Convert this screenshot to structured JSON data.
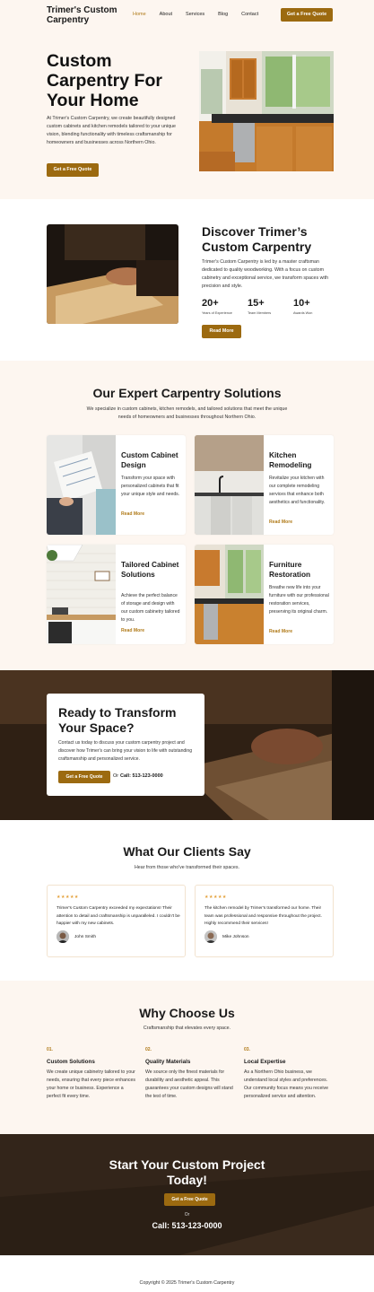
{
  "header": {
    "logo": "Trimer's Custom Carpentry",
    "nav": [
      "Home",
      "About",
      "Services",
      "Blog",
      "Contact"
    ],
    "active": "Home",
    "cta": "Get a Free Quote"
  },
  "hero": {
    "title": "Custom Carpentry For Your Home",
    "text": "At Trimer's Custom Carpentry, we create beautifully designed custom cabinets and kitchen remodels tailored to your unique vision, blending functionality with timeless craftsmanship for homeowners and businesses across Northern Ohio.",
    "button": "Get a Free Quote"
  },
  "discover": {
    "title": "Discover Trimer’s Custom Carpentry",
    "text": "Trimer's Custom Carpentry is led by a master craftsman dedicated to quality woodworking. With a focus on custom cabinetry and exceptional service, we transform spaces with precision and style.",
    "stats": [
      {
        "num": "20+",
        "label": "Years of Experience"
      },
      {
        "num": "15+",
        "label": "Team Members"
      },
      {
        "num": "10+",
        "label": "Awards Won"
      }
    ],
    "button": "Read More"
  },
  "services": {
    "title": "Our Expert Carpentry Solutions",
    "subtitle": "We specialize in custom cabinets, kitchen remodels, and tailored solutions that meet the unique needs of homeowners and businesses throughout Northern Ohio.",
    "cards": [
      {
        "title": "Custom Cabinet Design",
        "text": "Transform your space with personalized cabinets that fit your unique style and needs.",
        "link": "Read More"
      },
      {
        "title": "Kitchen Remodeling",
        "text": "Revitalize your kitchen with our complete remodeling services that enhance both aesthetics and functionality.",
        "link": "Read More"
      },
      {
        "title": "Tailored Cabinet Solutions",
        "text": "Achieve the perfect balance of storage and design with our custom cabinetry tailored to you.",
        "link": "Read More"
      },
      {
        "title": "Furniture Restoration",
        "text": "Breathe new life into your furniture with our professional restoration services, preserving its original charm.",
        "link": "Read More"
      }
    ]
  },
  "cta": {
    "title": "Ready to Transform Your Space?",
    "text": "Contact us today to discuss your custom carpentry project and discover how Trimer's can bring your vision to life with outstanding craftsmanship and personalized service.",
    "button": "Get a Free Quote",
    "or": "Or",
    "call": "Call: 513-123-0000"
  },
  "testimonials": {
    "title": "What Our Clients Say",
    "subtitle": "Hear from those who've transformed their spaces.",
    "items": [
      {
        "stars": "★★★★★",
        "quote": "Trimer's Custom Carpentry exceeded my expectations! Their attention to detail and craftsmanship is unparalleled. I couldn't be happier with my new cabinets.",
        "name": "John Smith"
      },
      {
        "stars": "★★★★★",
        "quote": "The kitchen remodel by Trimer's transformed our home. Their team was professional and responsive throughout the project. Highly recommend their services!",
        "name": "Mike Johnson"
      }
    ]
  },
  "why": {
    "title": "Why Choose Us",
    "subtitle": "Craftsmanship that elevates every space.",
    "items": [
      {
        "num": "01.",
        "title": "Custom Solutions",
        "text": "We create unique cabinetry tailored to your needs, ensuring that every piece enhances your home or business. Experience a perfect fit every time."
      },
      {
        "num": "02.",
        "title": "Quality Materials",
        "text": "We source only the finest materials for durability and aesthetic appeal. This guarantees your custom designs will stand the test of time."
      },
      {
        "num": "03.",
        "title": "Local Expertise",
        "text": "As a Northern Ohio business, we understand local styles and preferences. Our community focus means you receive personalized service and attention."
      }
    ]
  },
  "final": {
    "title": "Start Your Custom Project Today!",
    "button": "Get a Free Quote",
    "or": "Or",
    "call": "Call: 513-123-0000"
  },
  "footer": {
    "copyright": "Copyright © 2025 Trimer's Custom Carpentry"
  },
  "colors": {
    "accent": "#9c6a10",
    "cream": "#fdf6f0",
    "dark": "#2e2116"
  }
}
